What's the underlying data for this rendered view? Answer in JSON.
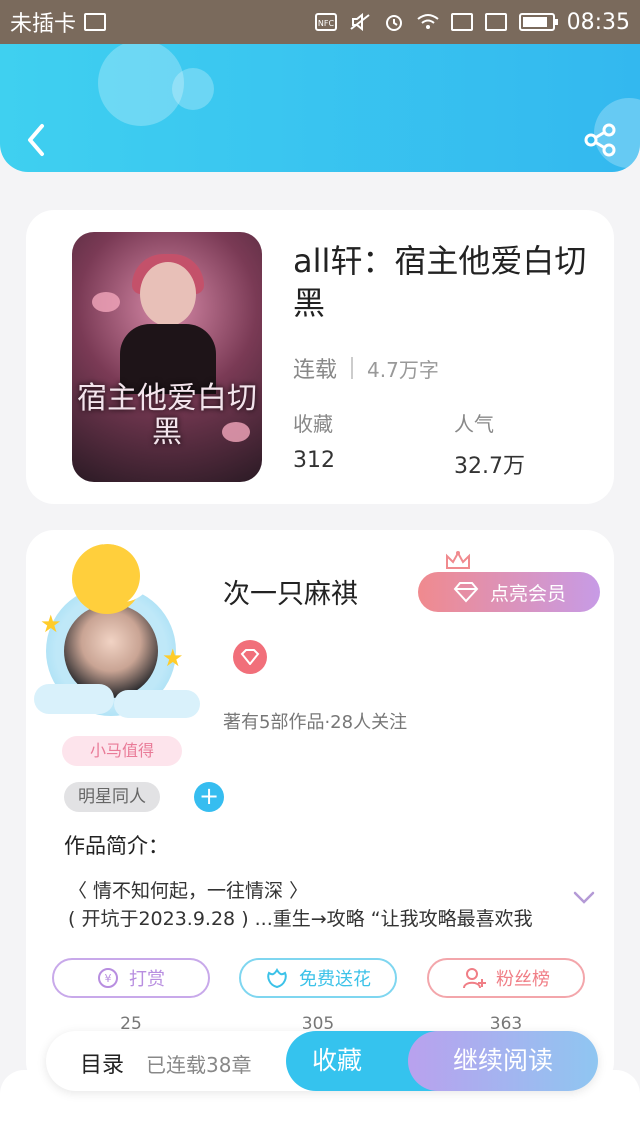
{
  "status_bar": {
    "carrier": "未插卡",
    "time": "08:35",
    "icons": [
      "sim-icon",
      "nfc-icon",
      "mute-icon",
      "alarm-icon",
      "wifi-icon",
      "sim1-icon",
      "sim2-icon",
      "battery-icon"
    ]
  },
  "header": {
    "back_icon": "back-arrow-icon",
    "share_icon": "share-icon",
    "colors": {
      "from": "#3fd0f0",
      "to": "#33b8ef"
    }
  },
  "book": {
    "title": "all轩：宿主他爱白切黑",
    "cover_text": "宿主他爱白切黑",
    "status": "连载",
    "word_count": "4.7万字",
    "stats": [
      {
        "label": "收藏",
        "value": "312"
      },
      {
        "label": "人气",
        "value": "32.7万"
      }
    ]
  },
  "author": {
    "name": "次一只麻祺",
    "vip_button": "点亮会员",
    "badge_label": "小马值得",
    "works_info": "著有5部作品·28人关注"
  },
  "tags": [
    "明星同人"
  ],
  "intro": {
    "title": "作品简介：",
    "lines": [
      "〈 情不知何起，一往情深 〉",
      "( 开坑于2023.9.28 ) ...重生→攻略 “让我攻略最喜欢我"
    ]
  },
  "actions": [
    {
      "label": "打赏",
      "count": "25",
      "icon": "yen-icon",
      "color": "#b88ee0"
    },
    {
      "label": "免费送花",
      "count": "305",
      "icon": "flower-icon",
      "color": "#3cc2e8"
    },
    {
      "label": "粉丝榜",
      "count": "363",
      "icon": "fans-icon",
      "color": "#f07e86"
    }
  ],
  "bottom_bar": {
    "toc_label": "目录",
    "toc_sub": "已连载38章",
    "favorite_button": "收藏",
    "read_button": "继续阅读"
  }
}
